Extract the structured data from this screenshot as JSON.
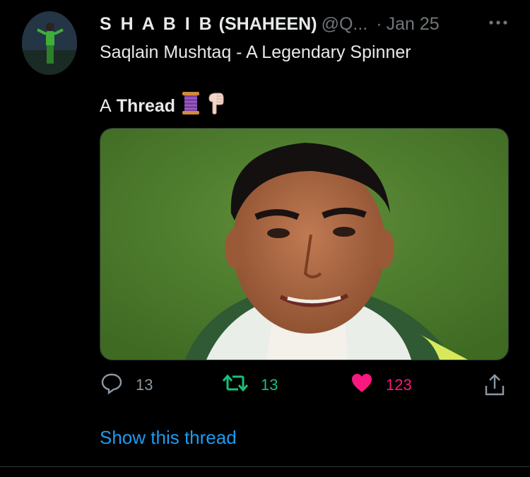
{
  "tweet": {
    "author": {
      "name_lead": "S H A B I B",
      "name_rest": " (SHAHEEN)",
      "handle": "@Q...",
      "separator": "·",
      "date": "Jan 25"
    },
    "more_icon": "ellipsis-icon",
    "text_line1": "Saqlain Mushtaq - A Legendary Spinner",
    "text_line2_prefix": "A",
    "text_line2_bold": "Thread",
    "emojis": [
      "spool-of-thread-icon",
      "pointing-down-hand-icon"
    ],
    "actions": {
      "replies": "13",
      "retweets": "13",
      "likes": "123"
    },
    "show_thread": "Show this thread"
  },
  "colors": {
    "background": "#000000",
    "text": "#e7e9ea",
    "muted": "#71767b",
    "retweet_green": "#19bf7c",
    "like_pink": "#f91880",
    "link_blue": "#1d9bf0"
  }
}
